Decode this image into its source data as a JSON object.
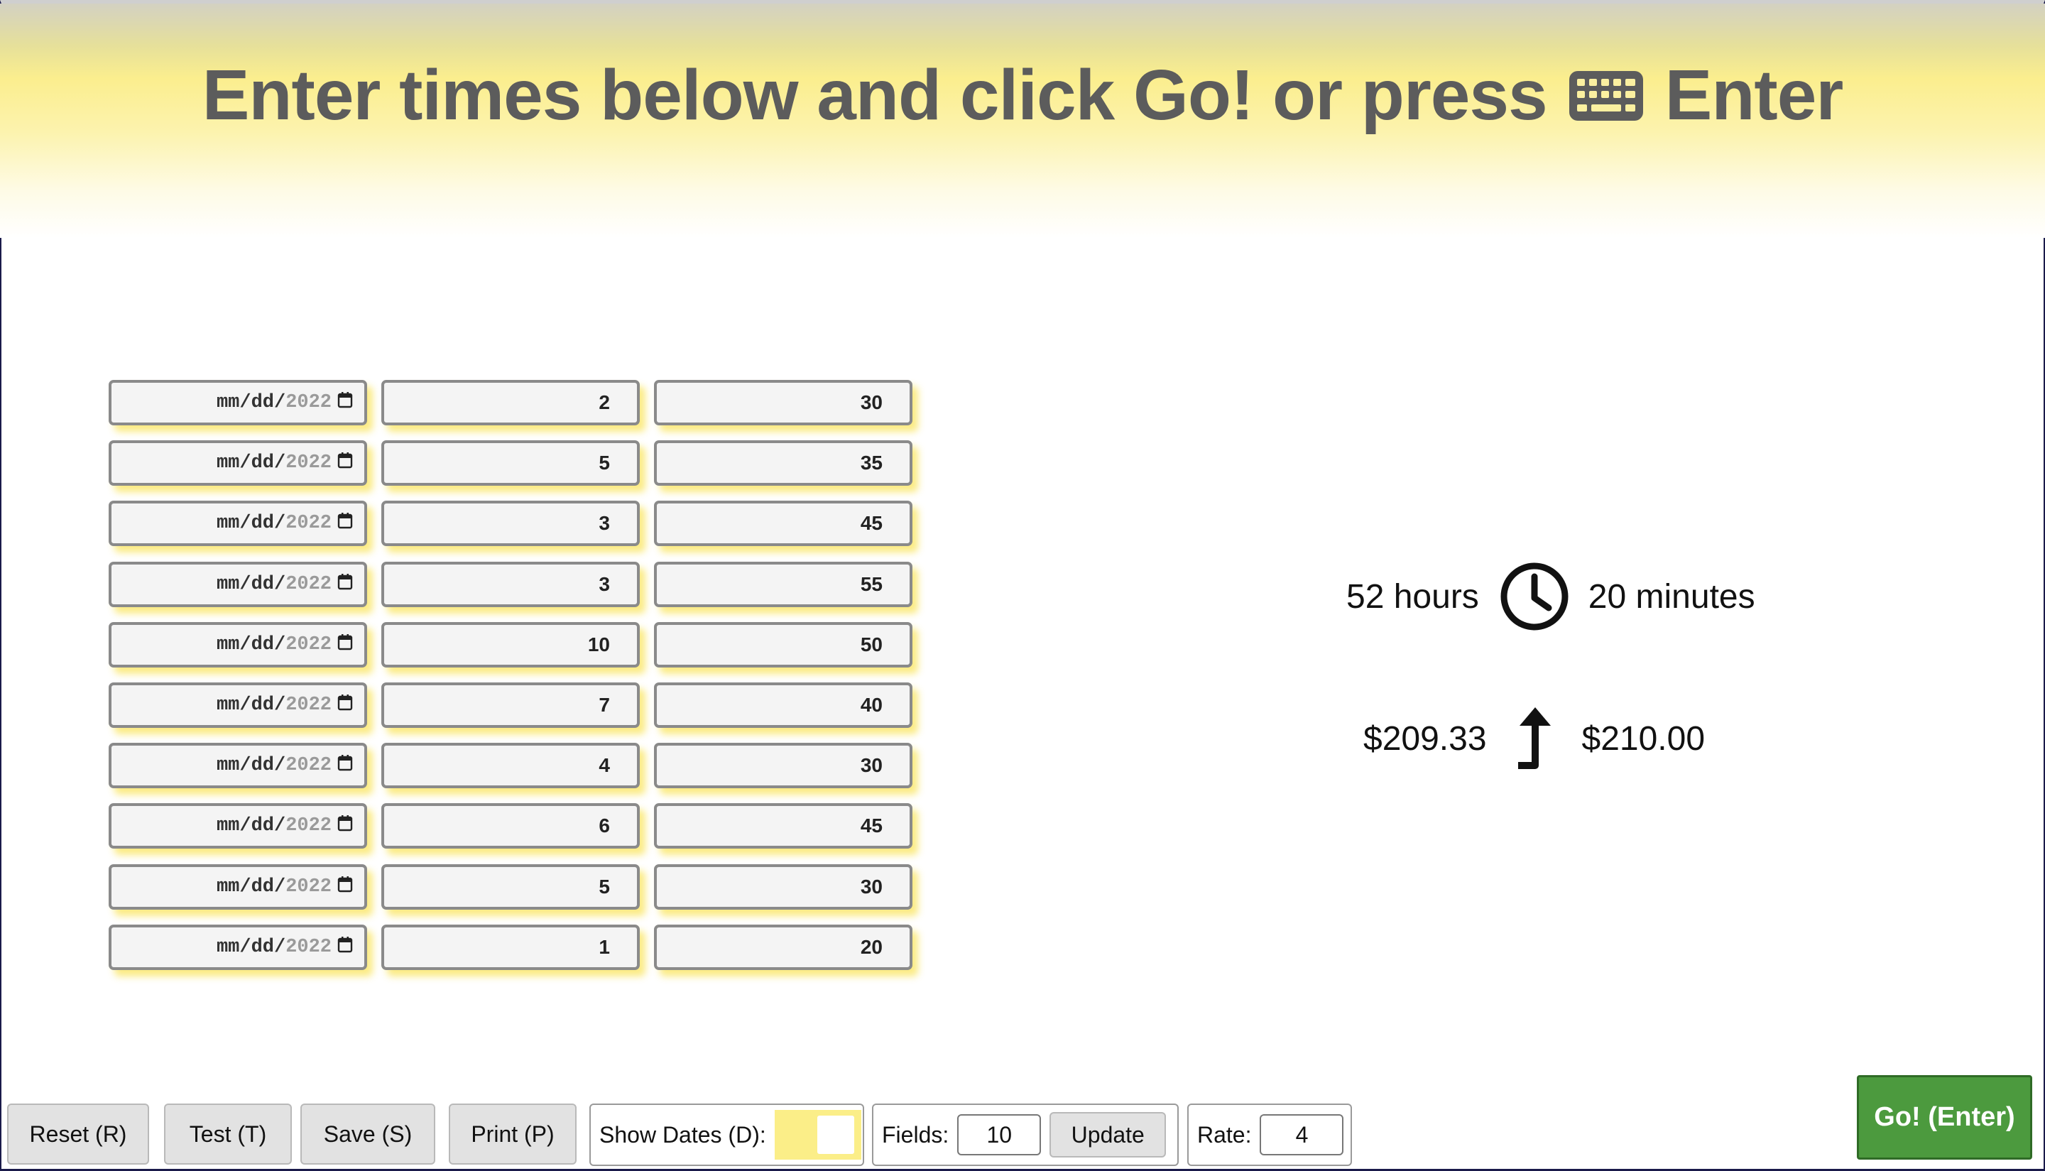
{
  "header": {
    "title_text": "Enter times below and click Go! or press",
    "title_key": "Enter",
    "icon": "keyboard-icon"
  },
  "entries": [
    {
      "date": {
        "mm": "mm",
        "dd": "dd",
        "yyyy": "2022"
      },
      "hours": "2",
      "minutes": "30"
    },
    {
      "date": {
        "mm": "mm",
        "dd": "dd",
        "yyyy": "2022"
      },
      "hours": "5",
      "minutes": "35"
    },
    {
      "date": {
        "mm": "mm",
        "dd": "dd",
        "yyyy": "2022"
      },
      "hours": "3",
      "minutes": "45"
    },
    {
      "date": {
        "mm": "mm",
        "dd": "dd",
        "yyyy": "2022"
      },
      "hours": "3",
      "minutes": "55"
    },
    {
      "date": {
        "mm": "mm",
        "dd": "dd",
        "yyyy": "2022"
      },
      "hours": "10",
      "minutes": "50"
    },
    {
      "date": {
        "mm": "mm",
        "dd": "dd",
        "yyyy": "2022"
      },
      "hours": "7",
      "minutes": "40"
    },
    {
      "date": {
        "mm": "mm",
        "dd": "dd",
        "yyyy": "2022"
      },
      "hours": "4",
      "minutes": "30"
    },
    {
      "date": {
        "mm": "mm",
        "dd": "dd",
        "yyyy": "2022"
      },
      "hours": "6",
      "minutes": "45"
    },
    {
      "date": {
        "mm": "mm",
        "dd": "dd",
        "yyyy": "2022"
      },
      "hours": "5",
      "minutes": "30"
    },
    {
      "date": {
        "mm": "mm",
        "dd": "dd",
        "yyyy": "2022"
      },
      "hours": "1",
      "minutes": "20"
    }
  ],
  "results": {
    "hours": "52 hours",
    "minutes": "20 minutes",
    "amount": "$209.33",
    "rounded_amount": "$210.00",
    "time_icon": "clock-icon",
    "round_icon": "arrow-up-icon"
  },
  "toolbar": {
    "reset_label": "Reset (R)",
    "test_label": "Test (T)",
    "save_label": "Save (S)",
    "print_label": "Print (P)",
    "show_dates_label": "Show Dates (D):",
    "fields_label": "Fields:",
    "fields_value": "10",
    "update_label": "Update",
    "rate_label": "Rate:",
    "rate_value": "4",
    "go_label": "Go! (Enter)"
  },
  "colors": {
    "accent_yellow": "#fbee8e",
    "go_green": "#4c9a3e",
    "title_gray": "#5c5c5c"
  }
}
